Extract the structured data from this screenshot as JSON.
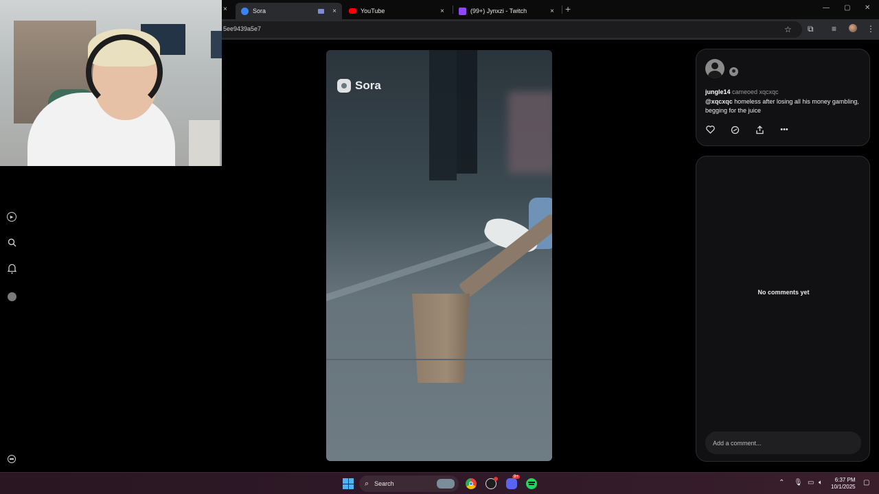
{
  "browser": {
    "tabs": [
      {
        "label": "Sora",
        "active": true
      },
      {
        "label": "YouTube",
        "active": false
      },
      {
        "label": "(99+) Jynxzi - Twitch",
        "active": false
      }
    ],
    "tab_close": "×",
    "new_tab": "+",
    "url_fragment": "5ee9439a5e7",
    "window_controls": {
      "minimize": "—",
      "maximize": "▢",
      "close": "✕"
    },
    "icons": [
      "star-icon",
      "extensions-icon",
      "media-control-icon",
      "profile-avatar",
      "kebab-menu-icon"
    ]
  },
  "video": {
    "watermark": "Sora"
  },
  "post": {
    "username": "jungle14",
    "cameo_text": " cameoed xqcxqc",
    "mention": "@xqcxqc",
    "caption": " homeless after losing all his money gambling, begging for the juice",
    "actions": [
      "heart-icon",
      "remix-icon",
      "share-icon",
      "more-icon"
    ]
  },
  "comments": {
    "empty_text": "No comments yet",
    "input_placeholder": "Add a comment..."
  },
  "taskbar": {
    "search_label": "Search",
    "apps": [
      "chrome-icon",
      "obs-icon",
      "discord-icon",
      "spotify-icon"
    ],
    "discord_badge": "9+",
    "time": "6:37 PM",
    "date": "10/1/2025"
  },
  "colors": {
    "page_bg": "#000000",
    "card_bg": "#111113",
    "taskbar": "#2e1828",
    "spotify": "#1ed760",
    "windows_blue": "#4fb2f3"
  }
}
